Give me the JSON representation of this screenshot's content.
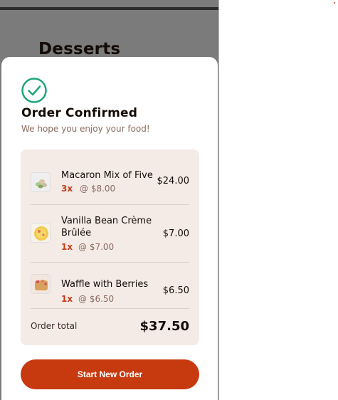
{
  "background_page": {
    "title": "Desserts"
  },
  "modal": {
    "icon": "check-circle-icon",
    "title": "Order Confirmed",
    "subtitle": "We hope you enjoy your food!",
    "items": [
      {
        "name": "Macaron Mix of Five",
        "quantity": "3x",
        "unit_price": "@ $8.00",
        "line_total": "$24.00",
        "thumbnail": "macaron-thumbnail"
      },
      {
        "name": "Vanilla Bean Crème Brûlée",
        "name_line1": "Vanilla Bean Crème",
        "name_line2": "Brûlée",
        "quantity": "1x",
        "unit_price": "@ $7.00",
        "line_total": "$7.00",
        "thumbnail": "creme-brulee-thumbnail"
      },
      {
        "name": "Waffle with Berries",
        "quantity": "1x",
        "unit_price": "@ $6.50",
        "line_total": "$6.50",
        "thumbnail": "waffle-thumbnail"
      }
    ],
    "order_total_label": "Order total",
    "order_total_value": "$37.50",
    "start_button_label": "Start New Order"
  },
  "colors": {
    "accent": "#c73a10",
    "success_green": "#1ea475",
    "card_bg": "#f4ebe7",
    "overlay": "#7b7b7b"
  }
}
